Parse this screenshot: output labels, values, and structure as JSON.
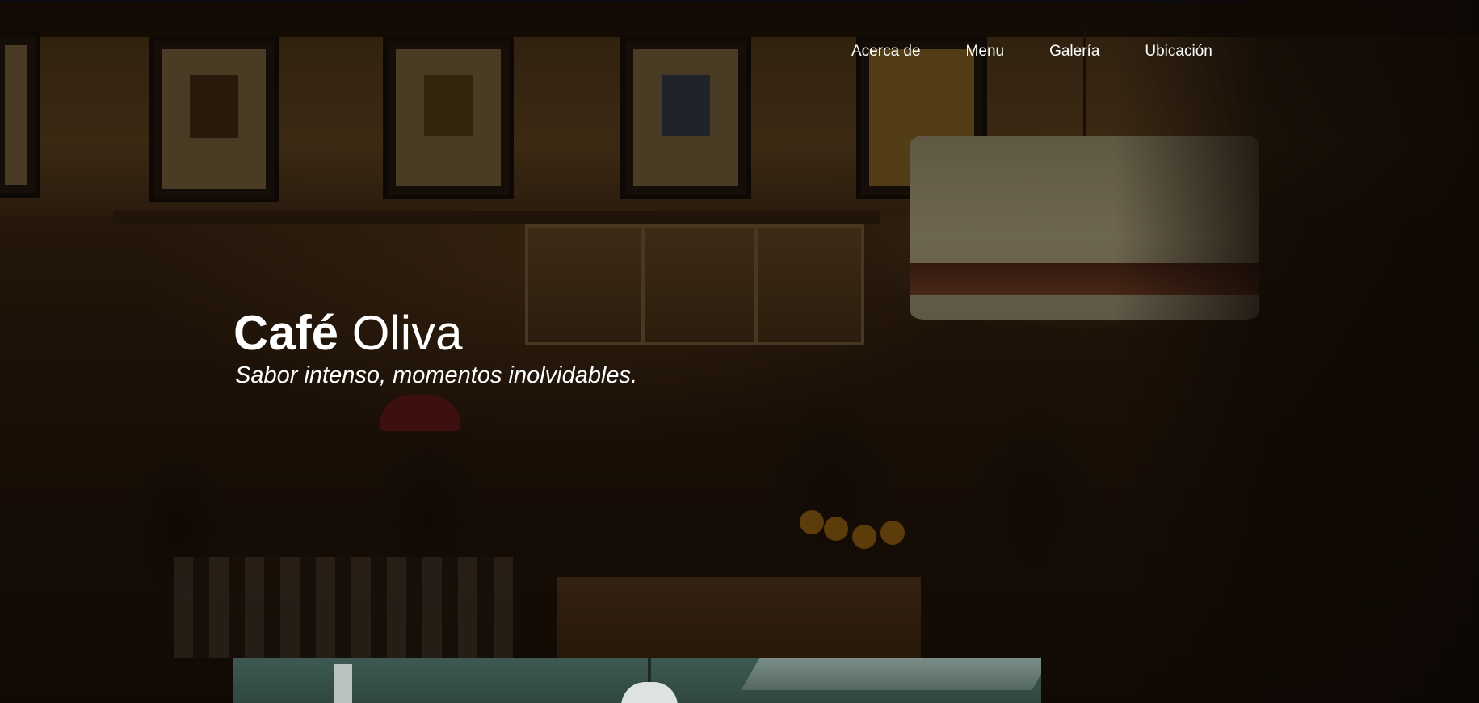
{
  "nav": {
    "items": [
      {
        "label": "Acerca de"
      },
      {
        "label": "Menu"
      },
      {
        "label": "Galería"
      },
      {
        "label": "Ubicación"
      }
    ]
  },
  "hero": {
    "title_bold": "Café",
    "title_regular": "Oliva",
    "subtitle": "Sabor intenso, momentos inolvidables."
  },
  "colors": {
    "text": "#ffffff",
    "background_dark": "#120904"
  }
}
